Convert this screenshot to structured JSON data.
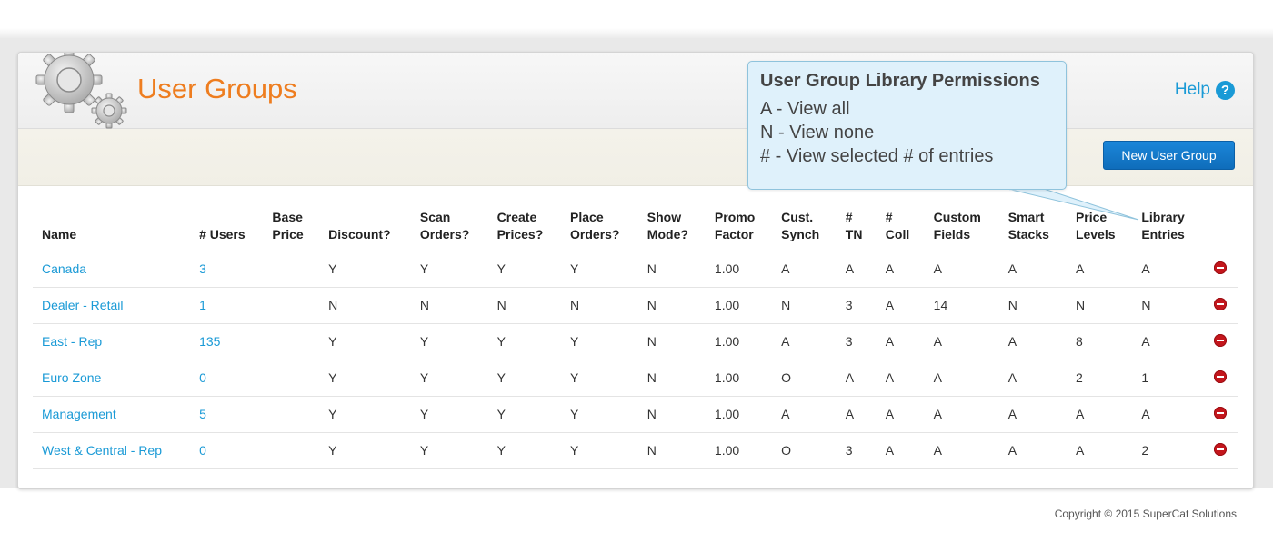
{
  "page": {
    "title": "User Groups",
    "help_label": "Help",
    "new_button_label": "New User Group",
    "copyright": "Copyright © 2015 SuperCat Solutions"
  },
  "tooltip": {
    "title": "User Group Library Permissions",
    "lines": [
      "A - View all",
      "N - View none",
      "# - View selected # of entries"
    ]
  },
  "table": {
    "columns": [
      {
        "line1": "",
        "line2": "Name"
      },
      {
        "line1": "",
        "line2": "# Users"
      },
      {
        "line1": "Base",
        "line2": "Price"
      },
      {
        "line1": "",
        "line2": "Discount?"
      },
      {
        "line1": "Scan",
        "line2": "Orders?"
      },
      {
        "line1": "Create",
        "line2": "Prices?"
      },
      {
        "line1": "Place",
        "line2": "Orders?"
      },
      {
        "line1": "Show",
        "line2": "Mode?"
      },
      {
        "line1": "Promo",
        "line2": "Factor"
      },
      {
        "line1": "Cust.",
        "line2": "Synch"
      },
      {
        "line1": "#",
        "line2": "TN"
      },
      {
        "line1": "#",
        "line2": "Coll"
      },
      {
        "line1": "Custom",
        "line2": "Fields"
      },
      {
        "line1": "Smart",
        "line2": "Stacks"
      },
      {
        "line1": "Price",
        "line2": "Levels"
      },
      {
        "line1": "Library",
        "line2": "Entries"
      },
      {
        "line1": "",
        "line2": ""
      }
    ],
    "rows": [
      [
        "Canada",
        "3",
        "",
        "Y",
        "Y",
        "Y",
        "Y",
        "N",
        "1.00",
        "A",
        "A",
        "A",
        "A",
        "A",
        "A",
        "A"
      ],
      [
        "Dealer - Retail",
        "1",
        "",
        "N",
        "N",
        "N",
        "N",
        "N",
        "1.00",
        "N",
        "3",
        "A",
        "14",
        "N",
        "N",
        "N"
      ],
      [
        "East - Rep",
        "135",
        "",
        "Y",
        "Y",
        "Y",
        "Y",
        "N",
        "1.00",
        "A",
        "3",
        "A",
        "A",
        "A",
        "8",
        "A"
      ],
      [
        "Euro Zone",
        "0",
        "",
        "Y",
        "Y",
        "Y",
        "Y",
        "N",
        "1.00",
        "O",
        "A",
        "A",
        "A",
        "A",
        "2",
        "1"
      ],
      [
        "Management",
        "5",
        "",
        "Y",
        "Y",
        "Y",
        "Y",
        "N",
        "1.00",
        "A",
        "A",
        "A",
        "A",
        "A",
        "A",
        "A"
      ],
      [
        "West & Central - Rep",
        "0",
        "",
        "Y",
        "Y",
        "Y",
        "Y",
        "N",
        "1.00",
        "O",
        "3",
        "A",
        "A",
        "A",
        "A",
        "2"
      ]
    ]
  },
  "icons": {
    "logo": "gears-icon",
    "help": "help-circle-icon",
    "delete": "delete-icon"
  },
  "colors": {
    "title": "#ee7d1f",
    "link": "#1a9ad6",
    "button": "#1b86d9",
    "delete": "#c4161c",
    "tooltip_bg": "#dff1fb"
  }
}
